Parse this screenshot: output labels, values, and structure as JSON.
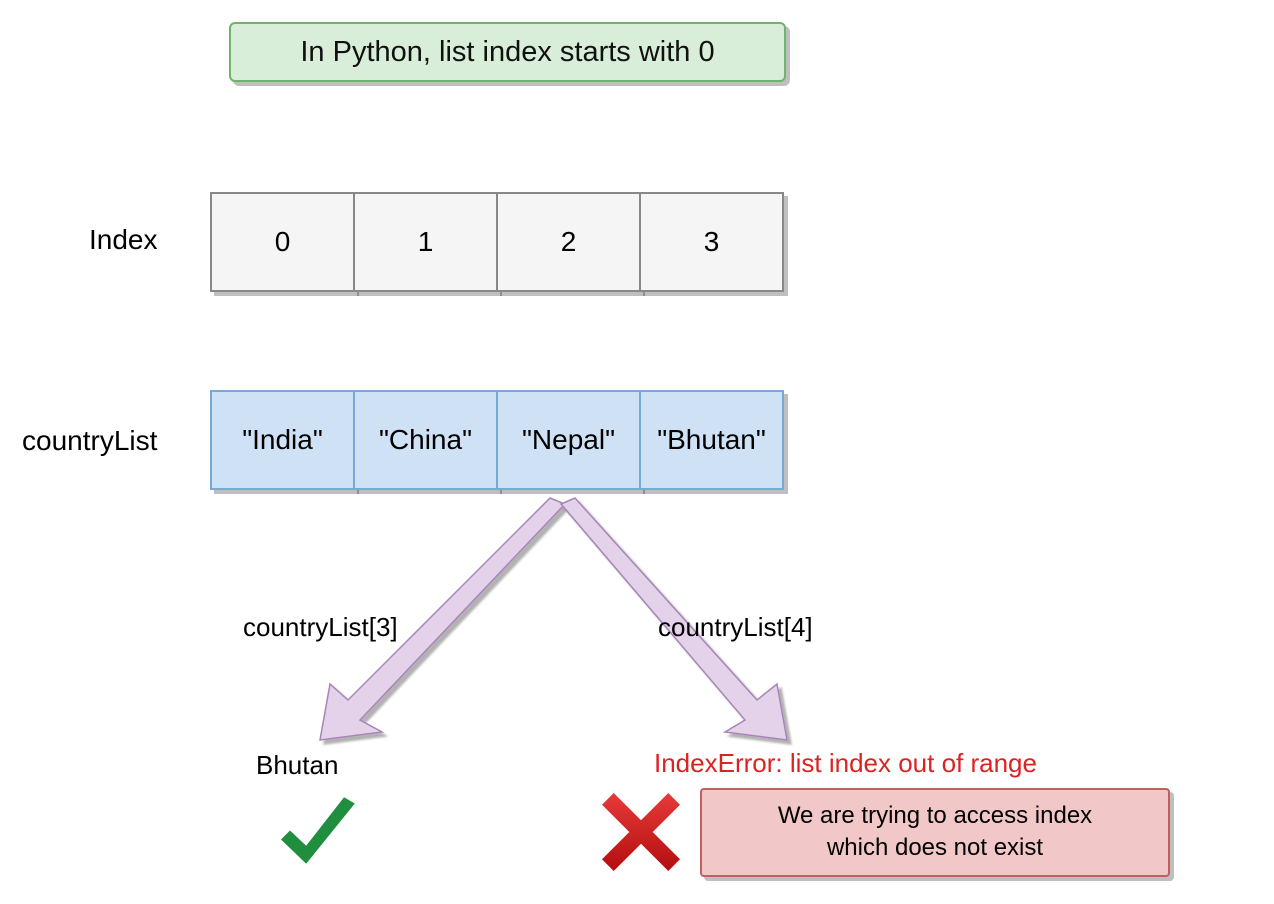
{
  "title": "In Python, list index starts with 0",
  "labels": {
    "index": "Index",
    "listName": "countryList"
  },
  "indices": [
    "0",
    "1",
    "2",
    "3"
  ],
  "values": [
    "\"India\"",
    "\"China\"",
    "\"Nepal\"",
    "\"Bhutan\""
  ],
  "leftExpr": "countryList[3]",
  "rightExpr": "countryList[4]",
  "leftResult": "Bhutan",
  "errorMsg": "IndexError: list index out of range",
  "errorBoxLine1": "We are trying to access index",
  "errorBoxLine2": "which does not exist"
}
